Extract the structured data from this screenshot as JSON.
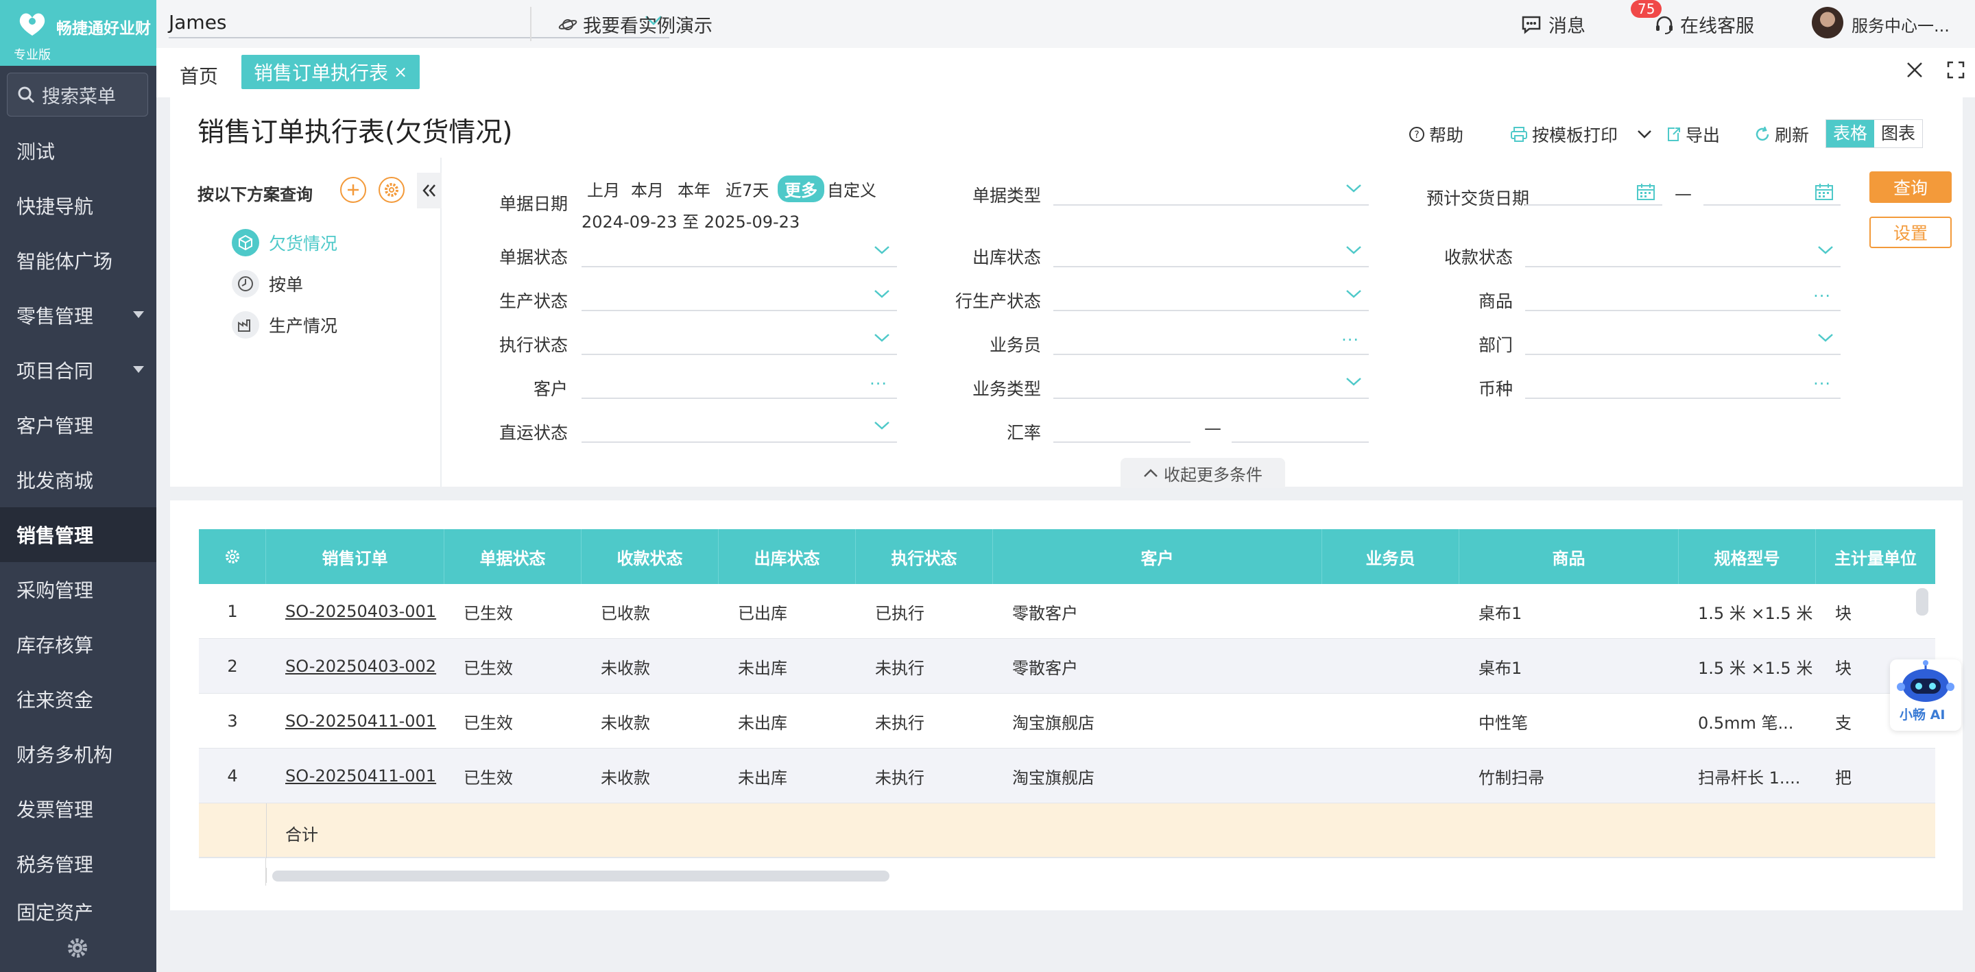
{
  "app": {
    "brand_name": "畅捷通好业财",
    "edition": "专业版",
    "search_placeholder": "搜索菜单",
    "menu": [
      {
        "label": "测试",
        "expandable": false
      },
      {
        "label": "快捷导航",
        "expandable": false
      },
      {
        "label": "智能体广场",
        "expandable": false
      },
      {
        "label": "零售管理",
        "expandable": true
      },
      {
        "label": "项目合同",
        "expandable": true
      },
      {
        "label": "客户管理",
        "expandable": false
      },
      {
        "label": "批发商城",
        "expandable": false
      },
      {
        "label": "销售管理",
        "expandable": false,
        "active": true
      },
      {
        "label": "采购管理",
        "expandable": false
      },
      {
        "label": "库存核算",
        "expandable": false
      },
      {
        "label": "往来资金",
        "expandable": false
      },
      {
        "label": "财务多机构",
        "expandable": false
      },
      {
        "label": "发票管理",
        "expandable": false
      },
      {
        "label": "税务管理",
        "expandable": false
      },
      {
        "label": "固定资产",
        "expandable": false
      }
    ]
  },
  "topbar": {
    "company": "James",
    "demo": "我要看实例演示",
    "messages": "消息",
    "message_count": "75",
    "support": "在线客服",
    "service_center": "服务中心一..."
  },
  "tabs": {
    "home": "首页",
    "active": "销售订单执行表",
    "active_close": "×"
  },
  "page": {
    "title": "销售订单执行表(欠货情况)",
    "help": "帮助",
    "print": "按模板打印",
    "export": "导出",
    "refresh": "刷新",
    "view_table": "表格",
    "view_chart": "图表"
  },
  "query": {
    "scheme_title": "按以下方案查询",
    "schemes": [
      {
        "label": "欠货情况",
        "selected": true
      },
      {
        "label": "按单",
        "selected": false
      },
      {
        "label": "生产情况",
        "selected": false
      }
    ],
    "date_label": "单据日期",
    "date_chips": [
      "上月",
      "本月",
      "本年",
      "近7天",
      "更多",
      "自定义"
    ],
    "date_chip_selected": "更多",
    "date_range": "2024-09-23 至 2025-09-23",
    "fields": {
      "doc_type": "单据类型",
      "expected_delivery": "预计交货日期",
      "doc_status": "单据状态",
      "outbound_status": "出库状态",
      "payment_status": "收款状态",
      "production_status": "生产状态",
      "row_production_status": "行生产状态",
      "product": "商品",
      "exec_status": "执行状态",
      "salesperson": "业务员",
      "department": "部门",
      "customer": "客户",
      "business_type": "业务类型",
      "currency": "币种",
      "direct_status": "直运状态",
      "exchange_rate": "汇率"
    },
    "range_dash": "—",
    "btn_query": "查询",
    "btn_settings": "设置",
    "collapse_more": "收起更多条件"
  },
  "grid": {
    "columns": [
      "销售订单",
      "单据状态",
      "收款状态",
      "出库状态",
      "执行状态",
      "客户",
      "业务员",
      "商品",
      "规格型号",
      "主计量单位"
    ],
    "rows": [
      {
        "no": "1",
        "order": "SO-20250403-001",
        "doc_status": "已生效",
        "pay_status": "已收款",
        "out_status": "已出库",
        "exec_status": "已执行",
        "customer": "零散客户",
        "salesperson": "",
        "product": "桌布1",
        "spec": "1.5 米 ×1.5 米",
        "unit": "块"
      },
      {
        "no": "2",
        "order": "SO-20250403-002",
        "doc_status": "已生效",
        "pay_status": "未收款",
        "out_status": "未出库",
        "exec_status": "未执行",
        "customer": "零散客户",
        "salesperson": "",
        "product": "桌布1",
        "spec": "1.5 米 ×1.5 米",
        "unit": "块"
      },
      {
        "no": "3",
        "order": "SO-20250411-001",
        "doc_status": "已生效",
        "pay_status": "未收款",
        "out_status": "未出库",
        "exec_status": "未执行",
        "customer": "淘宝旗舰店",
        "salesperson": "",
        "product": "中性笔",
        "spec": "0.5mm 笔...",
        "unit": "支"
      },
      {
        "no": "4",
        "order": "SO-20250411-001",
        "doc_status": "已生效",
        "pay_status": "未收款",
        "out_status": "未出库",
        "exec_status": "未执行",
        "customer": "淘宝旗舰店",
        "salesperson": "",
        "product": "竹制扫帚",
        "spec": "扫帚杆长 1....",
        "unit": "把"
      }
    ],
    "summary": "合计"
  },
  "ai": {
    "label": "小畅 AI"
  },
  "colors": {
    "accent": "#4ec9c9",
    "orange": "#f39a3a",
    "sidebar": "#353d4d",
    "badge": "#f04848"
  }
}
